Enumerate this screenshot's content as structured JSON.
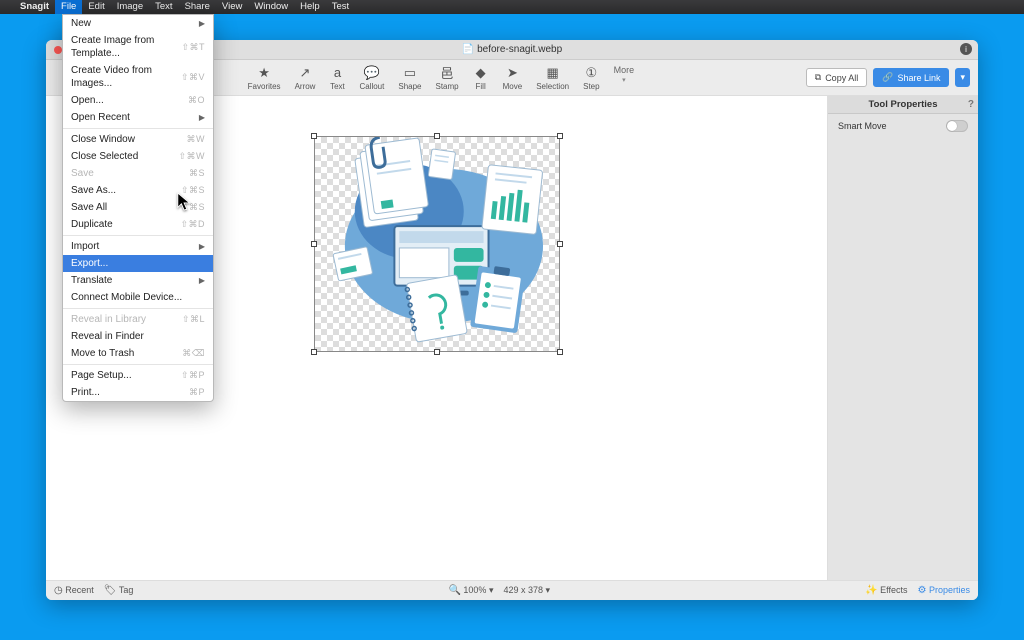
{
  "os": {
    "app_name": "Snagit"
  },
  "menubar": [
    "File",
    "Edit",
    "Image",
    "Text",
    "Share",
    "View",
    "Window",
    "Help",
    "Test"
  ],
  "menubar_active_index": 0,
  "window": {
    "title_prefix": "📄 ",
    "title": "before-snagit.webp"
  },
  "toolbar": {
    "tools": [
      {
        "label": "Favorites",
        "icon": "★"
      },
      {
        "label": "Arrow",
        "icon": "↗"
      },
      {
        "label": "Text",
        "icon": "a"
      },
      {
        "label": "Callout",
        "icon": "💬"
      },
      {
        "label": "Shape",
        "icon": "▭"
      },
      {
        "label": "Stamp",
        "icon": "⾢"
      },
      {
        "label": "Fill",
        "icon": "◆"
      },
      {
        "label": "Move",
        "icon": "➤"
      },
      {
        "label": "Selection",
        "icon": "▦"
      },
      {
        "label": "Step",
        "icon": "①"
      }
    ],
    "more": "More",
    "copy_all": "Copy All",
    "share_link": "Share Link"
  },
  "properties": {
    "title": "Tool Properties",
    "smart_move": "Smart Move"
  },
  "statusbar": {
    "recent": "Recent",
    "tag": "Tag",
    "zoom": "100%",
    "dims": "429 x 378",
    "effects": "Effects",
    "props": "Properties"
  },
  "file_menu": [
    {
      "t": "item",
      "label": "New",
      "shortcut": "",
      "sub": true
    },
    {
      "t": "item",
      "label": "Create Image from Template...",
      "shortcut": "⇧⌘T"
    },
    {
      "t": "item",
      "label": "Create Video from Images...",
      "shortcut": "⇧⌘V"
    },
    {
      "t": "item",
      "label": "Open...",
      "shortcut": "⌘O"
    },
    {
      "t": "item",
      "label": "Open Recent",
      "shortcut": "",
      "sub": true
    },
    {
      "t": "sep"
    },
    {
      "t": "item",
      "label": "Close Window",
      "shortcut": "⌘W"
    },
    {
      "t": "item",
      "label": "Close Selected",
      "shortcut": "⇧⌘W"
    },
    {
      "t": "item",
      "label": "Save",
      "shortcut": "⌘S",
      "disabled": true
    },
    {
      "t": "item",
      "label": "Save As...",
      "shortcut": "⇧⌘S"
    },
    {
      "t": "item",
      "label": "Save All",
      "shortcut": "⌃⌘S"
    },
    {
      "t": "item",
      "label": "Duplicate",
      "shortcut": "⇧⌘D"
    },
    {
      "t": "sep"
    },
    {
      "t": "item",
      "label": "Import",
      "shortcut": "",
      "sub": true
    },
    {
      "t": "item",
      "label": "Export...",
      "shortcut": "",
      "highlight": true
    },
    {
      "t": "item",
      "label": "Translate",
      "shortcut": "",
      "sub": true
    },
    {
      "t": "item",
      "label": "Connect Mobile Device...",
      "shortcut": ""
    },
    {
      "t": "sep"
    },
    {
      "t": "item",
      "label": "Reveal in Library",
      "shortcut": "⇧⌘L",
      "disabled": true
    },
    {
      "t": "item",
      "label": "Reveal in Finder",
      "shortcut": ""
    },
    {
      "t": "item",
      "label": "Move to Trash",
      "shortcut": "⌘⌫"
    },
    {
      "t": "sep"
    },
    {
      "t": "item",
      "label": "Page Setup...",
      "shortcut": "⇧⌘P"
    },
    {
      "t": "item",
      "label": "Print...",
      "shortcut": "⌘P"
    }
  ]
}
